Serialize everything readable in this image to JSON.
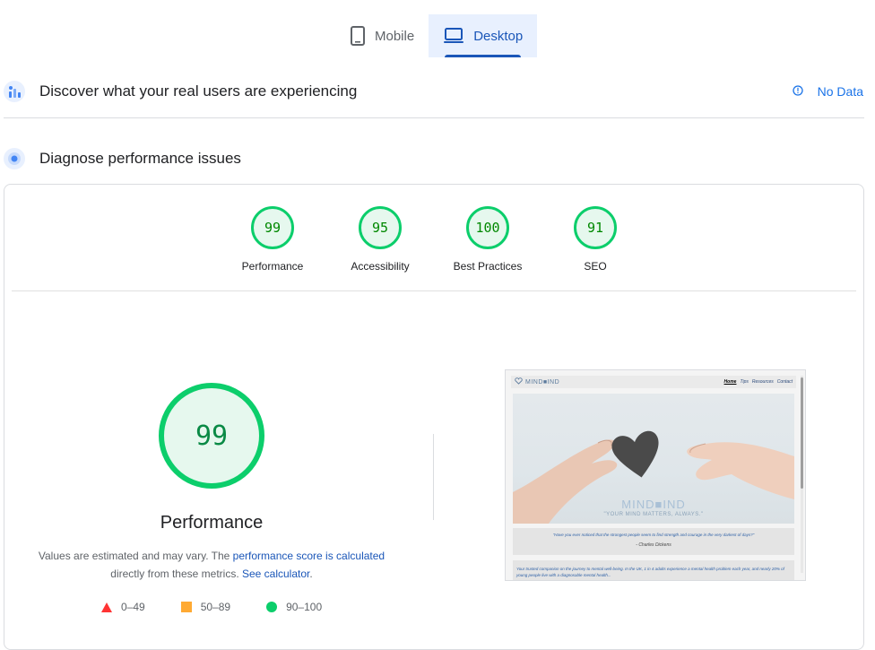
{
  "tabs": [
    {
      "label": "Mobile",
      "icon": "smartphone-icon",
      "active": false
    },
    {
      "label": "Desktop",
      "icon": "laptop-icon",
      "active": true
    }
  ],
  "field_section": {
    "title": "Discover what your real users are experiencing",
    "icon": "field-data-icon",
    "status_icon": "info-icon",
    "status_text": "No Data"
  },
  "lab_section": {
    "title": "Diagnose performance issues",
    "icon": "lab-data-icon"
  },
  "categories": [
    {
      "score": "99",
      "label": "Performance"
    },
    {
      "score": "95",
      "label": "Accessibility"
    },
    {
      "score": "100",
      "label": "Best Practices"
    },
    {
      "score": "91",
      "label": "SEO"
    }
  ],
  "performance": {
    "score": "99",
    "title": "Performance",
    "desc_prefix": "Values are estimated and may vary. The ",
    "desc_link1": "performance score is calculated",
    "desc_middle": " directly from these metrics. ",
    "desc_link2": "See calculator",
    "desc_suffix": "."
  },
  "legend": [
    {
      "shape": "triangle",
      "range": "0–49",
      "color": "#ff3333"
    },
    {
      "shape": "square",
      "range": "50–89",
      "color": "#ffaa33"
    },
    {
      "shape": "circle",
      "range": "90–100",
      "color": "#0cce6b"
    }
  ],
  "preview": {
    "logo": "MIND■IND",
    "nav_links": [
      "Home",
      "Tips",
      "Resources",
      "Contact"
    ],
    "hero_brand": "MIND■IND",
    "hero_tagline": "\"YOUR MIND MATTERS, ALWAYS.\"",
    "quote": "\"Have you ever noticed that the strongest people seem to find strength and courage in the very darkest of days?\"",
    "quote_author": "- Charles Dickens",
    "body_text": "Your trusted companion on the journey to mental well-being. In the UK, 1 in 4 adults experience a mental health problem each year, and nearly 20% of young people live with a diagnosable mental health..."
  },
  "colors": {
    "pass": "#0cce6b",
    "average": "#ffaa33",
    "fail": "#ff3333",
    "accent": "#1a56b8",
    "link": "#1a73e8"
  }
}
